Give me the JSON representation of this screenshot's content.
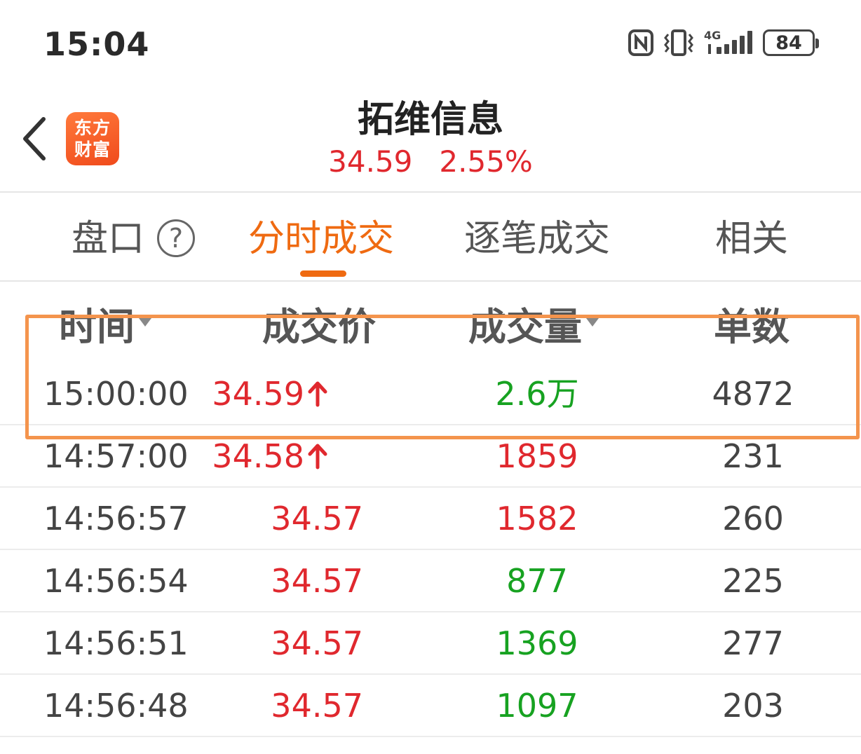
{
  "status_bar": {
    "time": "15:04",
    "network": "4G",
    "battery": "84",
    "icons": [
      "nfc-icon",
      "vibrate-icon",
      "signal-icon",
      "battery-icon"
    ]
  },
  "header": {
    "back_icon": "chevron-left-icon",
    "logo_line1": "东方",
    "logo_line2": "财富",
    "stock_name": "拓维信息",
    "price": "34.59",
    "change_pct": "2.55%"
  },
  "tabs": [
    {
      "label": "盘口",
      "help_icon": "?"
    },
    {
      "label": "分时成交",
      "active": true
    },
    {
      "label": "逐笔成交"
    },
    {
      "label": "相关"
    }
  ],
  "columns": {
    "time": "时间",
    "price": "成交价",
    "volume": "成交量",
    "count": "单数"
  },
  "rows": [
    {
      "time": "15:00:00",
      "price": "34.59",
      "price_arrow": "up",
      "volume": "2.6万",
      "volume_color": "green",
      "count": "4872"
    },
    {
      "time": "14:57:00",
      "price": "34.58",
      "price_arrow": "up",
      "volume": "1859",
      "volume_color": "red",
      "count": "231"
    },
    {
      "time": "14:56:57",
      "price": "34.57",
      "volume": "1582",
      "volume_color": "red",
      "count": "260"
    },
    {
      "time": "14:56:54",
      "price": "34.57",
      "volume": "877",
      "volume_color": "green",
      "count": "225"
    },
    {
      "time": "14:56:51",
      "price": "34.57",
      "volume": "1369",
      "volume_color": "green",
      "count": "277"
    },
    {
      "time": "14:56:48",
      "price": "34.57",
      "volume": "1097",
      "volume_color": "green",
      "count": "203"
    }
  ],
  "colors": {
    "up_red": "#e0282e",
    "down_green": "#17a221",
    "accent_orange": "#ef6a11",
    "highlight_border": "#f4944d"
  }
}
